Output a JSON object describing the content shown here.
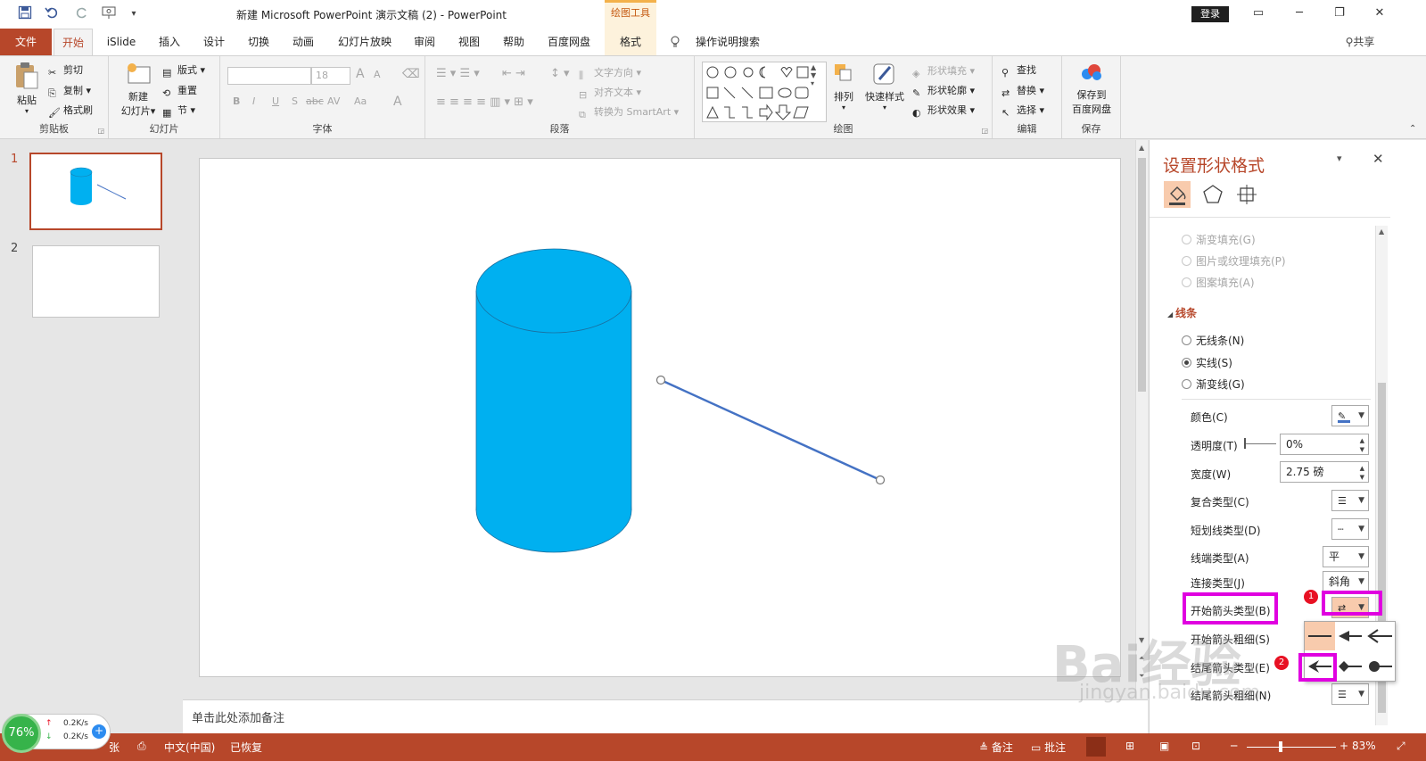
{
  "window": {
    "title": "新建 Microsoft PowerPoint 演示文稿 (2)  -  PowerPoint",
    "context_group": "绘图工具",
    "login_label": "登录",
    "share_label": "共享"
  },
  "tabs": [
    "文件",
    "开始",
    "iSlide",
    "插入",
    "设计",
    "切换",
    "动画",
    "幻灯片放映",
    "审阅",
    "视图",
    "帮助",
    "百度网盘",
    "格式"
  ],
  "tell_me": "操作说明搜索",
  "ribbon": {
    "clipboard": {
      "paste": "粘贴",
      "cut": "剪切",
      "copy": "复制",
      "format_painter": "格式刷",
      "label": "剪贴板"
    },
    "slides": {
      "new_slide_1": "新建",
      "new_slide_2": "幻灯片",
      "layout": "版式",
      "reset": "重置",
      "section": "节",
      "label": "幻灯片"
    },
    "font": {
      "size": "18",
      "label": "字体",
      "bold": "B",
      "italic": "I",
      "underline": "U",
      "strike": "S",
      "shadow": "abc",
      "spacing": "AV",
      "case": "Aa",
      "color": "A",
      "grow": "A",
      "shrink": "A"
    },
    "paragraph": {
      "text_direction": "文字方向",
      "align_text": "对齐文本",
      "smartart": "转换为 SmartArt",
      "label": "段落"
    },
    "drawing": {
      "arrange": "排列",
      "quick_styles": "快速样式",
      "shape_fill": "形状填充",
      "shape_outline": "形状轮廓",
      "shape_effects": "形状效果",
      "label": "绘图"
    },
    "editing": {
      "find": "查找",
      "replace": "替换",
      "select": "选择",
      "label": "编辑"
    },
    "save": {
      "save_1": "保存到",
      "save_2": "百度网盘",
      "label": "保存"
    }
  },
  "thumbnails": [
    {
      "num": "1"
    },
    {
      "num": "2"
    }
  ],
  "notes_placeholder": "单击此处添加备注",
  "pane": {
    "title": "设置形状格式",
    "fill_options": [
      "渐变填充(G)",
      "图片或纹理填充(P)",
      "图案填充(A)"
    ],
    "line_section": "线条",
    "line_options": [
      {
        "label": "无线条(N)",
        "checked": false
      },
      {
        "label": "实线(S)",
        "checked": true
      },
      {
        "label": "渐变线(G)",
        "checked": false
      }
    ],
    "color_label": "颜色(C)",
    "transparency_label": "透明度(T)",
    "transparency_value": "0%",
    "width_label": "宽度(W)",
    "width_value": "2.75 磅",
    "compound_label": "复合类型(C)",
    "dash_label": "短划线类型(D)",
    "cap_label": "线端类型(A)",
    "cap_value": "平",
    "join_label": "连接类型(J)",
    "join_value": "斜角",
    "begin_arrow_type": "开始箭头类型(B)",
    "begin_arrow_size": "开始箭头粗细(S)",
    "end_arrow_type": "结尾箭头类型(E)",
    "end_arrow_size": "结尾箭头粗细(N)",
    "badge_1": "1",
    "badge_2": "2"
  },
  "status": {
    "slide_info": "张",
    "language": "中文(中国)",
    "recovered": "已恢复",
    "notes": "备注",
    "comments": "批注",
    "zoom": "83%"
  },
  "net_widget": {
    "percent": "76%",
    "up": "0.2K/s",
    "down": "0.2K/s"
  },
  "watermark": {
    "main": "Bai经验",
    "sub": "jingyan.baidu.com"
  },
  "colors": {
    "accent": "#b7472a",
    "cylinder": "#00b0f0",
    "line": "#4472c4",
    "highlight": "#e000e0"
  }
}
